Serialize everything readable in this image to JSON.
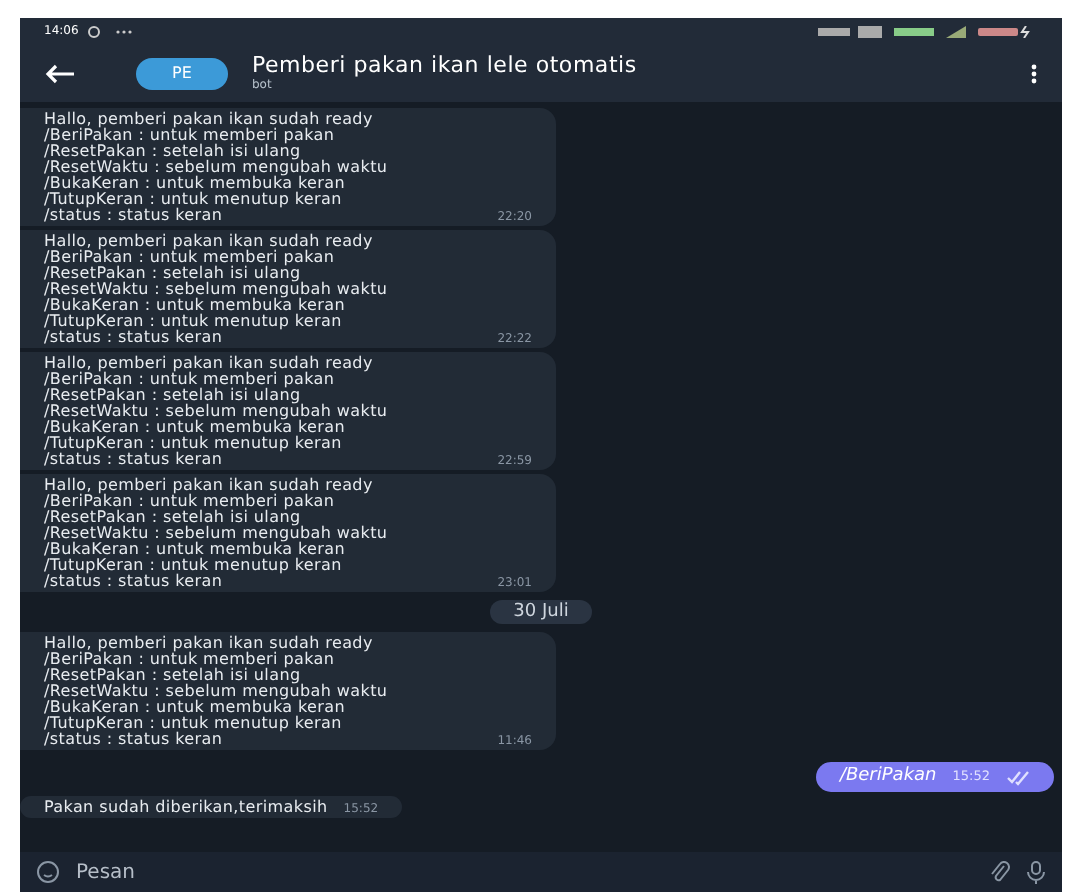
{
  "status_bar": {
    "time": "14:06"
  },
  "header": {
    "avatar": "PE",
    "title": "Pemberi pakan ikan lele otomatis",
    "subtitle": "bot"
  },
  "messages": [
    {
      "kind": "incoming",
      "lines": [
        "Hallo, pemberi pakan ikan sudah ready",
        "/BeriPakan : untuk memberi pakan",
        "/ResetPakan : setelah isi ulang",
        "/ResetWaktu : sebelum mengubah waktu",
        "/BukaKeran : untuk membuka keran",
        "/TutupKeran : untuk menutup keran",
        "/status : status keran"
      ],
      "time": "22:20"
    },
    {
      "kind": "incoming",
      "lines": [
        "Hallo, pemberi pakan ikan sudah ready",
        "/BeriPakan : untuk memberi pakan",
        "/ResetPakan : setelah isi ulang",
        "/ResetWaktu : sebelum mengubah waktu",
        "/BukaKeran : untuk membuka keran",
        "/TutupKeran : untuk menutup keran",
        "/status : status keran"
      ],
      "time": "22:22"
    },
    {
      "kind": "incoming",
      "lines": [
        "Hallo, pemberi pakan ikan sudah ready",
        "/BeriPakan : untuk memberi pakan",
        "/ResetPakan : setelah isi ulang",
        "/ResetWaktu : sebelum mengubah waktu",
        "/BukaKeran : untuk membuka keran",
        "/TutupKeran : untuk menutup keran",
        "/status : status keran"
      ],
      "time": "22:59"
    },
    {
      "kind": "incoming",
      "lines": [
        "Hallo, pemberi pakan ikan sudah ready",
        "/BeriPakan : untuk memberi pakan",
        "/ResetPakan : setelah isi ulang",
        "/ResetWaktu : sebelum mengubah waktu",
        "/BukaKeran : untuk membuka keran",
        "/TutupKeran : untuk menutup keran",
        "/status : status keran"
      ],
      "time": "23:01"
    },
    {
      "kind": "date",
      "text": "30 Juli"
    },
    {
      "kind": "incoming",
      "lines": [
        "Hallo, pemberi pakan ikan sudah ready",
        "/BeriPakan : untuk memberi pakan",
        "/ResetPakan : setelah isi ulang",
        "/ResetWaktu : sebelum mengubah waktu",
        "/BukaKeran : untuk membuka keran",
        "/TutupKeran : untuk menutup keran",
        "/status : status keran"
      ],
      "time": "11:46"
    },
    {
      "kind": "outgoing",
      "lines": [
        "/BeriPakan"
      ],
      "time": "15:52"
    },
    {
      "kind": "incoming",
      "lines": [
        "Pakan sudah diberikan,terimaksih"
      ],
      "time": "15:52"
    }
  ],
  "composer": {
    "placeholder": "Pesan"
  }
}
